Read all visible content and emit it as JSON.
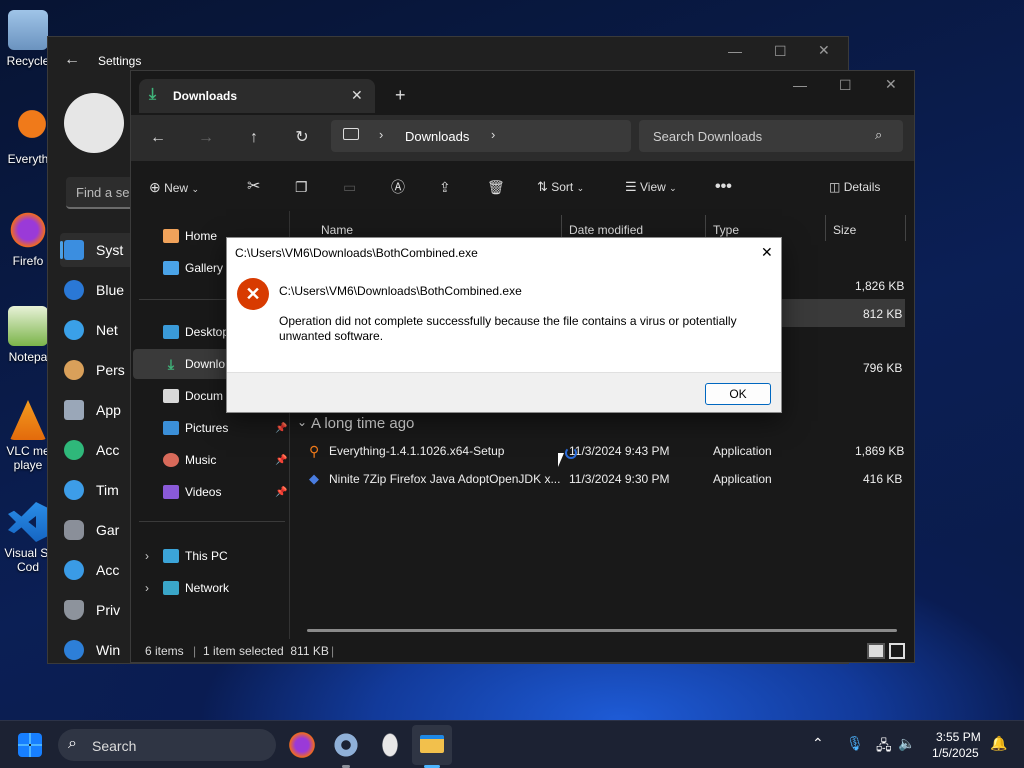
{
  "desktop": {
    "icons": [
      "Recycle",
      "Everyth",
      "Firefo",
      "Notepa",
      "VLC me",
      "playe",
      "Visual St",
      "Cod"
    ]
  },
  "settings": {
    "title": "Settings",
    "search_placeholder": "Find a se",
    "nav": [
      "Syst",
      "Blue",
      "Net",
      "Pers",
      "App",
      "Acc",
      "Tim",
      "Gar",
      "Acc",
      "Priv",
      "Win"
    ]
  },
  "explorer": {
    "tab_title": "Downloads",
    "address_current": "Downloads",
    "search_placeholder": "Search Downloads",
    "toolbar": {
      "new": "New",
      "sort": "Sort",
      "view": "View",
      "details": "Details"
    },
    "sidebar": [
      {
        "label": "Home",
        "icon": "home-icon"
      },
      {
        "label": "Gallery",
        "icon": "gallery-icon"
      },
      {
        "label": "Desktop",
        "icon": "desktop-icon"
      },
      {
        "label": "Downlo",
        "icon": "download-icon"
      },
      {
        "label": "Docum",
        "icon": "document-icon"
      },
      {
        "label": "Pictures",
        "icon": "pictures-icon"
      },
      {
        "label": "Music",
        "icon": "music-icon"
      },
      {
        "label": "Videos",
        "icon": "videos-icon"
      },
      {
        "label": "This PC",
        "icon": "pc-icon"
      },
      {
        "label": "Network",
        "icon": "network-icon"
      }
    ],
    "columns": {
      "name": "Name",
      "date": "Date modified",
      "type": "Type",
      "size": "Size"
    },
    "hidden_sizes": [
      "1,826 KB",
      "812 KB",
      "796 KB"
    ],
    "group_title": "A long time ago",
    "files": [
      {
        "name": "Everything-1.4.1.1026.x64-Setup",
        "date": "11/3/2024 9:43 PM",
        "type": "Application",
        "size": "1,869 KB"
      },
      {
        "name": "Ninite 7Zip Firefox Java AdoptOpenJDK x...",
        "date": "11/3/2024 9:30 PM",
        "type": "Application",
        "size": "416 KB"
      }
    ],
    "status": {
      "items": "6 items",
      "selected": "1 item selected  811 KB"
    }
  },
  "dialog": {
    "title": "C:\\Users\\VM6\\Downloads\\BothCombined.exe",
    "heading": "C:\\Users\\VM6\\Downloads\\BothCombined.exe",
    "message": "Operation did not complete successfully because the file contains a virus or potentially unwanted software.",
    "ok": "OK"
  },
  "taskbar": {
    "search": "Search",
    "time": "3:55 PM",
    "date": "1/5/2025"
  },
  "colors": {
    "accent": "#2b6bd8",
    "error": "#d83b01",
    "folder": "#f2c04c"
  }
}
